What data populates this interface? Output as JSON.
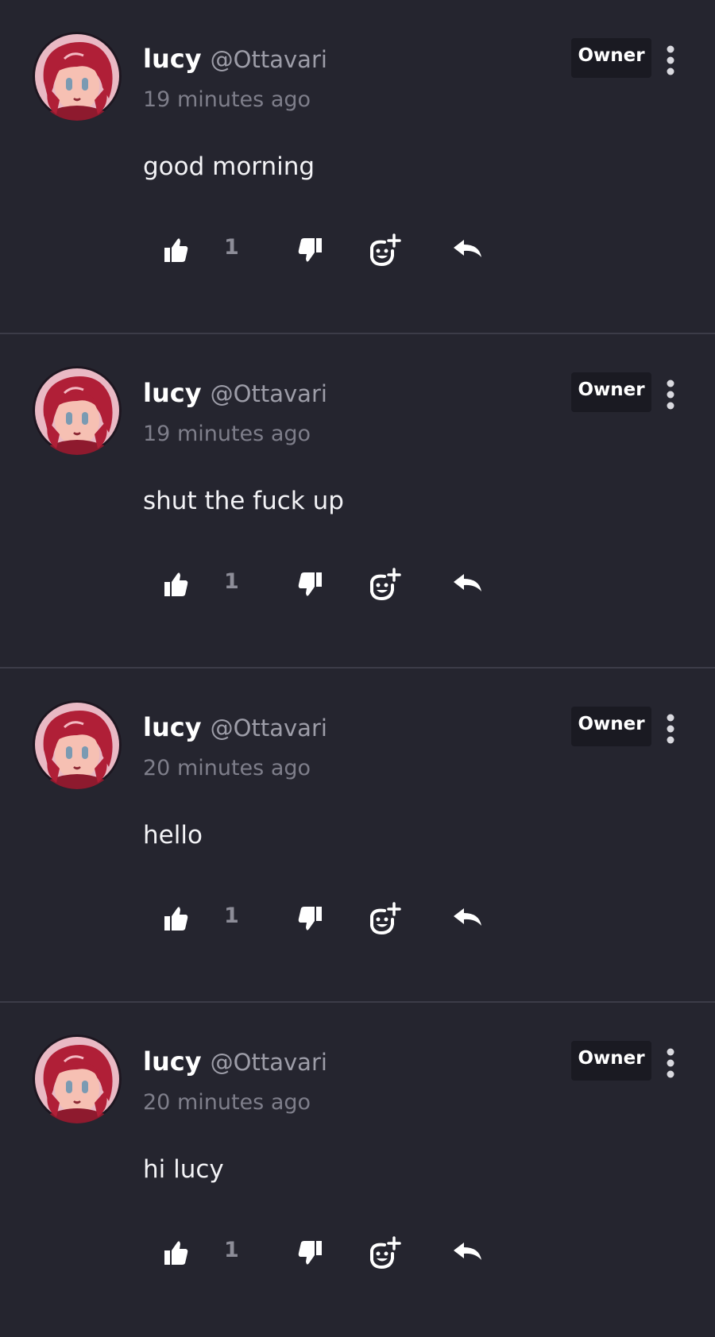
{
  "colors": {
    "background": "#25252f",
    "divider": "#3c3c48",
    "badge_background": "#1a1a22",
    "text_primary": "#ffffff",
    "text_secondary": "#9d9da8",
    "avatar_hair": "#b01f37",
    "avatar_bg": "#e9b9c4"
  },
  "icons": {
    "like": "thumbs-up-icon",
    "dislike": "thumbs-down-icon",
    "react": "add-reaction-icon",
    "reply": "reply-icon",
    "more": "vertical-ellipsis-icon"
  },
  "comments": [
    {
      "username": "lucy",
      "handle": "@Ottavari",
      "time": "19 minutes ago",
      "badge": "Owner",
      "text": "good morning",
      "likes": "1"
    },
    {
      "username": "lucy",
      "handle": "@Ottavari",
      "time": "19 minutes ago",
      "badge": "Owner",
      "text": "shut the fuck up",
      "likes": "1"
    },
    {
      "username": "lucy",
      "handle": "@Ottavari",
      "time": "20 minutes ago",
      "badge": "Owner",
      "text": "hello",
      "likes": "1"
    },
    {
      "username": "lucy",
      "handle": "@Ottavari",
      "time": "20 minutes ago",
      "badge": "Owner",
      "text": "hi lucy",
      "likes": "1"
    }
  ]
}
